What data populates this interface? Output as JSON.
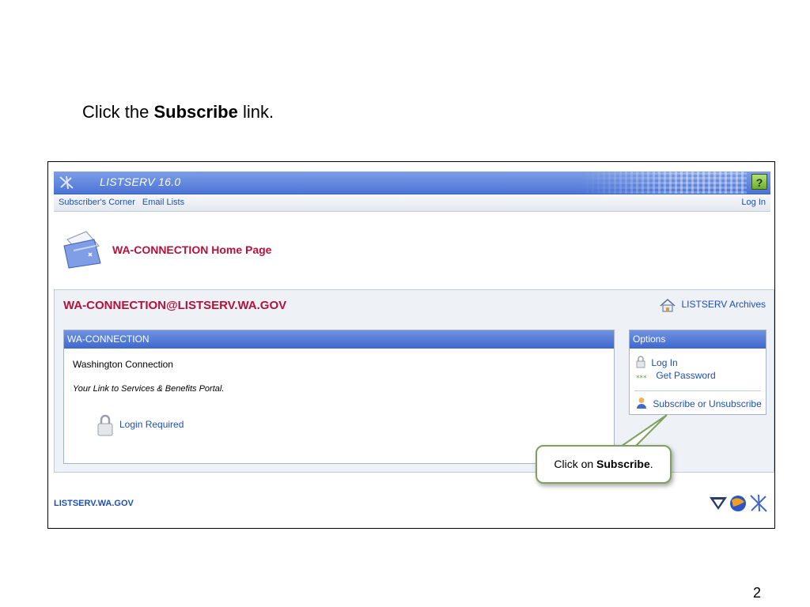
{
  "slide": {
    "instruction_prefix": "Click the",
    "instruction_bold": "Subscribe",
    "instruction_suffix": "link.",
    "page_number": "2"
  },
  "header": {
    "title": "LISTSERV 16.0",
    "help_label": "?"
  },
  "subnav": {
    "items": [
      "Subscriber's Corner",
      "Email Lists"
    ],
    "login": "Log In"
  },
  "page": {
    "title": "WA-CONNECTION Home Page"
  },
  "list": {
    "address": "WA-CONNECTION@LISTSERV.WA.GOV",
    "archives_link": "LISTSERV Archives",
    "box_title": "WA-CONNECTION",
    "name": "Washington Connection",
    "tagline": "Your Link to Services & Benefits Portal.",
    "login_required": "Login Required"
  },
  "options": {
    "title": "Options",
    "items": [
      "Log In",
      "Get Password",
      "Subscribe or Unsubscribe"
    ]
  },
  "callout": {
    "prefix": "Click on",
    "bold": "Subscribe",
    "suffix": "."
  },
  "footer": {
    "host_link": "LISTSERV.WA.GOV"
  },
  "colors": {
    "brand_red": "#b3133b",
    "link_blue": "#1f4fb0",
    "header_blue": "#4c74d6"
  }
}
